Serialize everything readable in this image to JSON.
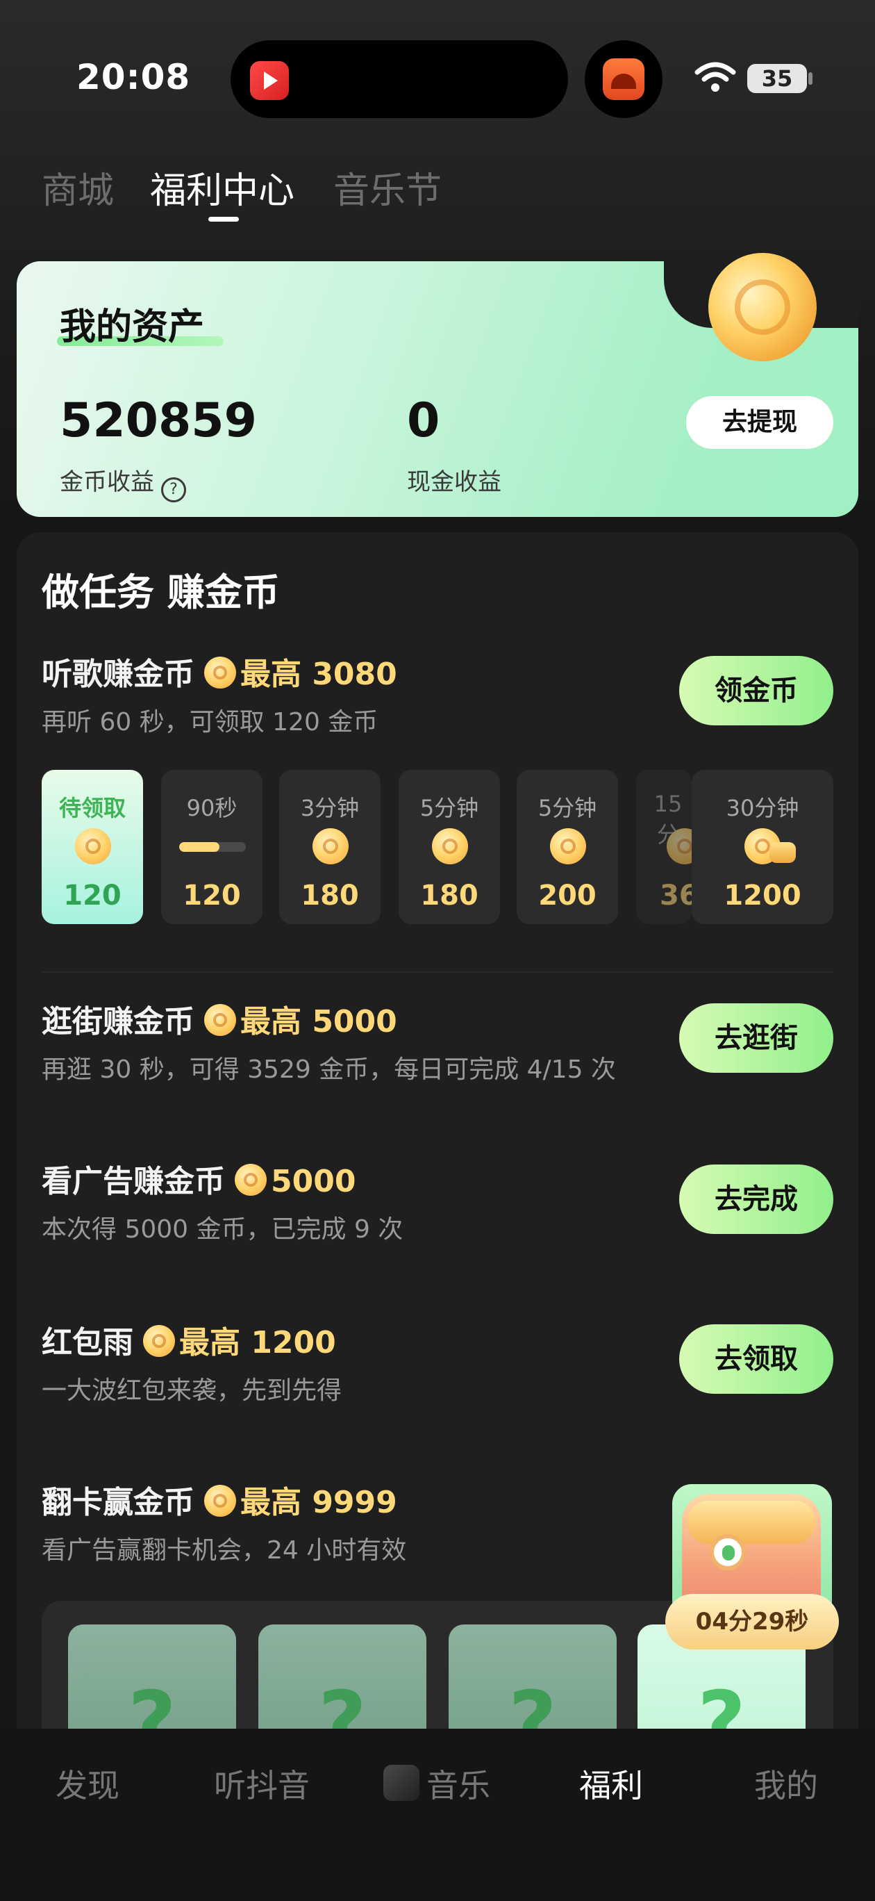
{
  "status_bar": {
    "time": "20:08",
    "battery": "35"
  },
  "top_tabs": [
    {
      "label": "商城"
    },
    {
      "label": "福利中心"
    },
    {
      "label": "音乐节"
    }
  ],
  "assets": {
    "title": "我的资产",
    "coins_value": "520859",
    "coins_label": "金币收益",
    "help_icon": "?",
    "cash_value": "0",
    "cash_label": "现金收益",
    "withdraw_button": "去提现"
  },
  "tasks_section": {
    "title": "做任务 赚金币",
    "listen": {
      "title": "听歌赚金币",
      "reward": "最高 3080",
      "subtitle": "再听 60 秒，可领取 120 金币",
      "button": "领金币",
      "tiles": [
        {
          "label": "待领取",
          "value": "120",
          "state": "active"
        },
        {
          "label": "90秒",
          "value": "120",
          "progress": 0.6
        },
        {
          "label": "3分钟",
          "value": "180"
        },
        {
          "label": "5分钟",
          "value": "180"
        },
        {
          "label": "5分钟",
          "value": "200"
        },
        {
          "label": "15分",
          "value": "36"
        },
        {
          "label": "30分钟",
          "value": "1200"
        }
      ]
    },
    "shopping": {
      "title": "逛街赚金币",
      "reward": "最高 5000",
      "subtitle": "再逛 30 秒，可得 3529 金币，每日可完成 4/15 次",
      "button": "去逛街"
    },
    "ads": {
      "title": "看广告赚金币",
      "reward": "5000",
      "subtitle": "本次得 5000 金币，已完成 9 次",
      "button": "去完成"
    },
    "red_packet": {
      "title": "红包雨",
      "reward": "最高 1200",
      "subtitle": "一大波红包来袭，先到先得",
      "button": "去领取"
    },
    "flip_card": {
      "title": "翻卡赢金币",
      "reward": "最高 9999",
      "subtitle": "看广告赢翻卡机会，24 小时有效",
      "cards": [
        "?",
        "?",
        "?",
        "?"
      ],
      "chest_timer": "04分29秒"
    }
  },
  "bottom_nav": [
    {
      "label": "发现"
    },
    {
      "label": "听抖音"
    },
    {
      "label": "音乐"
    },
    {
      "label": "福利"
    },
    {
      "label": "我的"
    }
  ]
}
